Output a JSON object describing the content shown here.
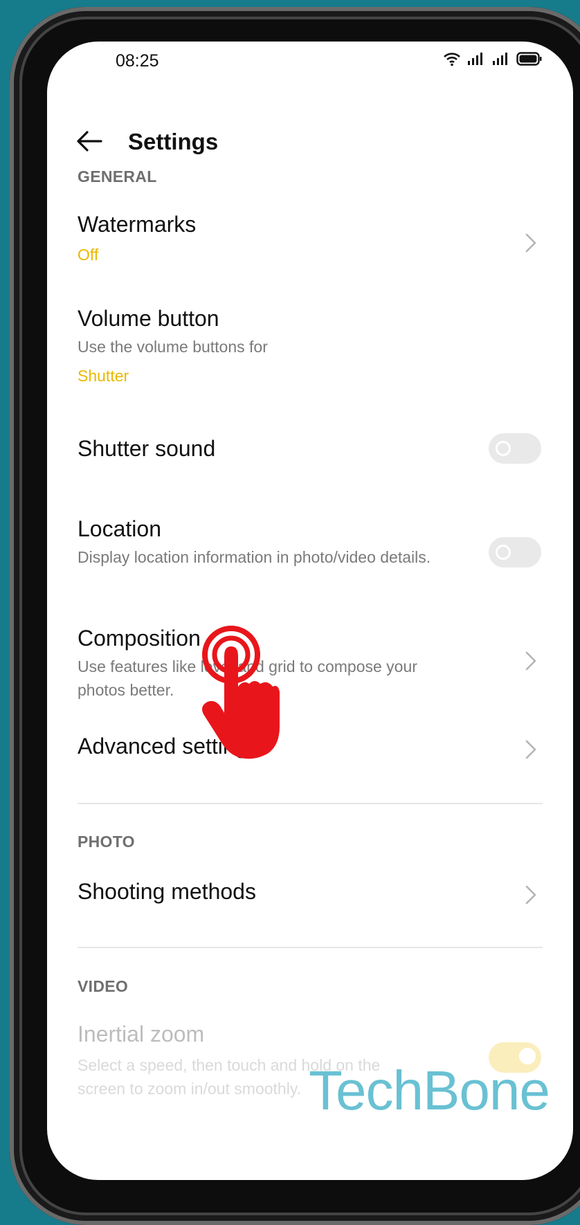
{
  "status": {
    "time": "08:25"
  },
  "header": {
    "title": "Settings"
  },
  "sections": {
    "general": "GENERAL",
    "photo": "PHOTO",
    "video": "VIDEO"
  },
  "items": {
    "watermarks": {
      "title": "Watermarks",
      "value": "Off"
    },
    "volume": {
      "title": "Volume button",
      "desc": "Use the volume buttons for",
      "value": "Shutter"
    },
    "shutter_sound": {
      "title": "Shutter sound",
      "enabled": false
    },
    "location": {
      "title": "Location",
      "desc": "Display location information in photo/video details.",
      "enabled": false
    },
    "composition": {
      "title": "Composition",
      "desc": "Use features like level and grid to compose your photos better."
    },
    "advanced": {
      "title": "Advanced settings"
    },
    "shooting": {
      "title": "Shooting methods"
    },
    "inertial": {
      "title": "Inertial zoom",
      "desc": "Select a speed, then touch and hold on the screen to zoom in/out smoothly.",
      "enabled": true
    }
  },
  "overlay": {
    "watermark": "TechBone"
  },
  "colors": {
    "accent": "#f3c316",
    "value_text": "#e8b800",
    "tap_hand": "#e8161b",
    "watermark": "#3fb0c7"
  }
}
